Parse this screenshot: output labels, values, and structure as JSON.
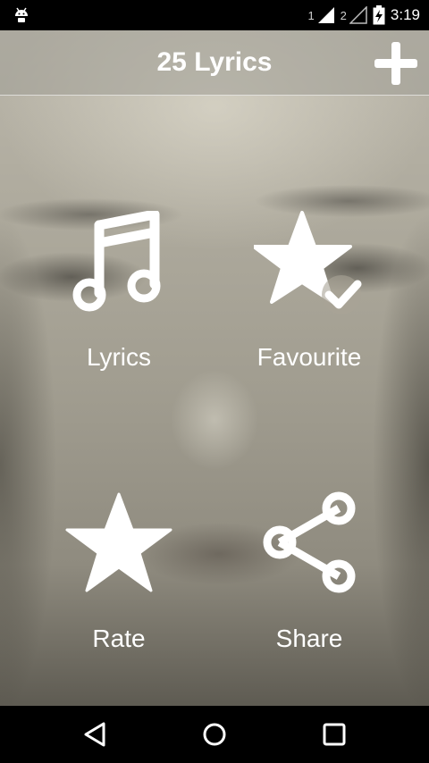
{
  "status_bar": {
    "sim1": "1",
    "sim2": "2",
    "time": "3:19",
    "icons": [
      "android-debug-icon",
      "signal-sim1-icon",
      "signal-sim2-icon",
      "battery-charging-icon"
    ]
  },
  "app_bar": {
    "title": "25 Lyrics",
    "add_icon": "plus-icon"
  },
  "menu": {
    "lyrics": {
      "label": "Lyrics",
      "icon": "music-note-icon"
    },
    "favourite": {
      "label": "Favourite",
      "icon": "star-check-icon"
    },
    "rate": {
      "label": "Rate",
      "icon": "star-icon"
    },
    "share": {
      "label": "Share",
      "icon": "share-icon"
    }
  },
  "nav_bar": {
    "icons": [
      "back-icon",
      "home-icon",
      "recents-icon"
    ]
  },
  "colors": {
    "text": "#ffffff",
    "status_bar": "#000000",
    "nav_bar": "#000000"
  }
}
